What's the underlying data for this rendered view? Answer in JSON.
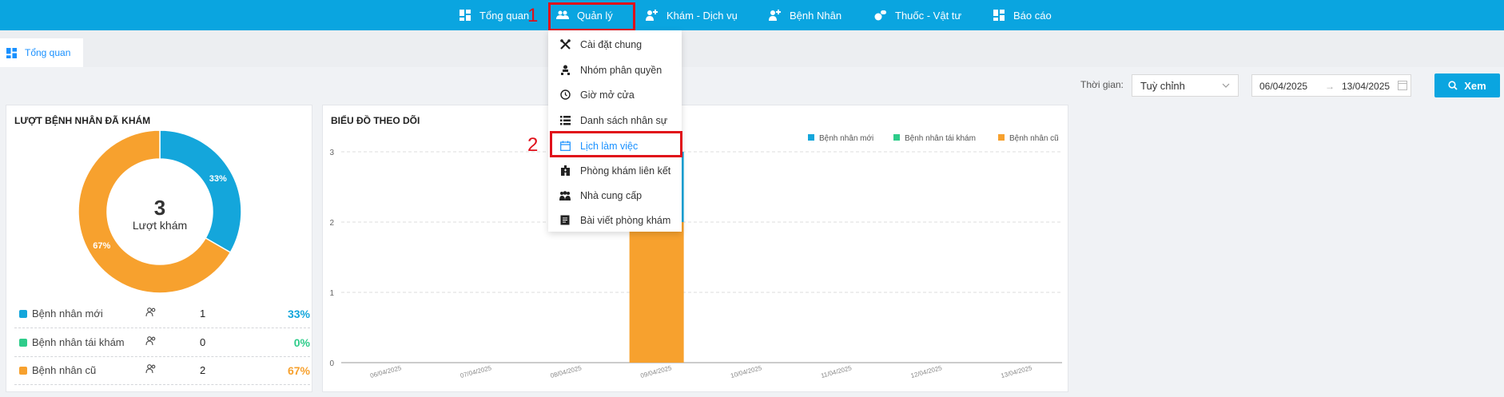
{
  "topnav": {
    "items": [
      {
        "label": "Tổng quan",
        "icon": "dashboard-icon"
      },
      {
        "label": "Quản lý",
        "icon": "users-icon"
      },
      {
        "label": "Khám - Dịch vụ",
        "icon": "user-medical-icon"
      },
      {
        "label": "Bệnh Nhân",
        "icon": "patient-icon"
      },
      {
        "label": "Thuốc - Vật tư",
        "icon": "pills-icon"
      },
      {
        "label": "Báo cáo",
        "icon": "report-icon"
      }
    ]
  },
  "annotations": {
    "step1": "1",
    "step2": "2"
  },
  "tabs": [
    {
      "label": "Tổng quan",
      "icon": "dashboard-icon"
    }
  ],
  "filter": {
    "label": "Thời gian:",
    "period": "Tuỳ chỉnh",
    "date_from": "06/04/2025",
    "date_sep": "→",
    "date_to": "13/04/2025",
    "view_button": "Xem"
  },
  "dropdown": {
    "items": [
      {
        "label": "Cài đặt chung",
        "icon": "settings-tools-icon"
      },
      {
        "label": "Nhóm phân quyền",
        "icon": "permission-group-icon"
      },
      {
        "label": "Giờ mở cửa",
        "icon": "clock-icon"
      },
      {
        "label": "Danh sách nhân sự",
        "icon": "list-icon"
      },
      {
        "label": "Lịch làm việc",
        "icon": "calendar-icon",
        "active": true
      },
      {
        "label": "Phòng khám liên kết",
        "icon": "hospital-icon"
      },
      {
        "label": "Nhà cung cấp",
        "icon": "supplier-icon"
      },
      {
        "label": "Bài viết phòng khám",
        "icon": "article-icon"
      }
    ]
  },
  "donut_card": {
    "title": "LƯỢT BỆNH NHÂN ĐÃ KHÁM",
    "center_value": "3",
    "center_label": "Lượt khám",
    "slice_labels": [
      "33%",
      "0%",
      "67%"
    ],
    "rows": [
      {
        "label": "Bệnh nhân mới",
        "count": "1",
        "percent": "33%",
        "color": "#14a6db"
      },
      {
        "label": "Bệnh nhân tái khám",
        "count": "0",
        "percent": "0%",
        "color": "#2ecc8a"
      },
      {
        "label": "Bệnh nhân cũ",
        "count": "2",
        "percent": "67%",
        "color": "#f7a12e"
      }
    ]
  },
  "chart_card": {
    "title": "BIỂU ĐỒ THEO DÕI"
  },
  "chart_data": [
    {
      "type": "pie",
      "categories": [
        "Bệnh nhân mới",
        "Bệnh nhân tái khám",
        "Bệnh nhân cũ"
      ],
      "values": [
        1,
        0,
        2
      ],
      "colors": [
        "#14a6db",
        "#2ecc8a",
        "#f7a12e"
      ]
    },
    {
      "type": "bar",
      "categories": [
        "06/04/2025",
        "07/04/2025",
        "08/04/2025",
        "09/04/2025",
        "10/04/2025",
        "11/04/2025",
        "12/04/2025",
        "13/04/2025"
      ],
      "series": [
        {
          "name": "Bệnh nhân mới",
          "color": "#14a6db",
          "values": [
            0,
            0,
            0,
            1,
            0,
            0,
            0,
            0
          ]
        },
        {
          "name": "Bệnh nhân tái khám",
          "color": "#2ecc8a",
          "values": [
            0,
            0,
            0,
            0,
            0,
            0,
            0,
            0
          ]
        },
        {
          "name": "Bệnh nhân cũ",
          "color": "#f7a12e",
          "values": [
            0,
            0,
            0,
            2,
            0,
            0,
            0,
            0
          ]
        }
      ],
      "stacked": true,
      "yticks": [
        "0",
        "1",
        "2",
        "3"
      ],
      "ylim": [
        0,
        3
      ],
      "grid": true,
      "legend": "top-right"
    }
  ]
}
